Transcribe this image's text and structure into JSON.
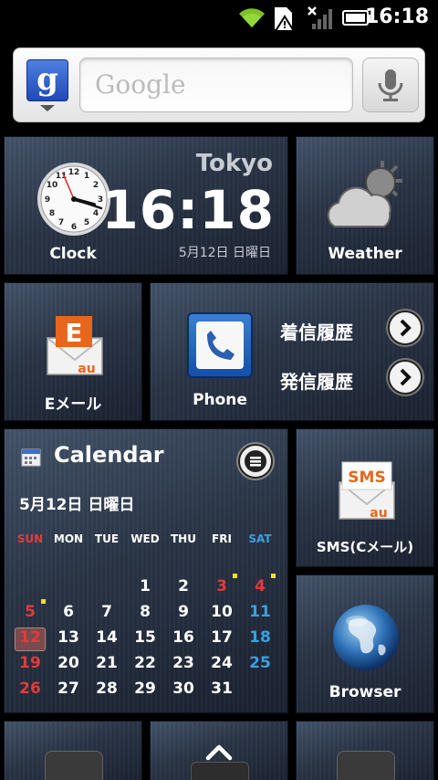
{
  "status_bar": {
    "time": "16:18",
    "icons": [
      "wifi-icon",
      "sd-card-warning-icon",
      "no-signal-icon",
      "battery-icon"
    ]
  },
  "search": {
    "logo": "g",
    "placeholder": "Google"
  },
  "tiles": {
    "clock": {
      "label": "Clock",
      "city": "Tokyo",
      "time": "16:18",
      "date": "5月12日 日曜日"
    },
    "weather": {
      "label": "Weather"
    },
    "email": {
      "label": "Eメール",
      "badge": "E",
      "brand": "au"
    },
    "phone": {
      "label": "Phone",
      "incoming": "着信履歴",
      "outgoing": "発信履歴"
    },
    "sms": {
      "label": "SMS(Cメール)",
      "badge": "SMS",
      "brand": "au"
    },
    "browser": {
      "label": "Browser"
    }
  },
  "calendar": {
    "title": "Calendar",
    "date": "5月12日 日曜日",
    "weekdays": [
      "SUN",
      "MON",
      "TUE",
      "WED",
      "THU",
      "FRI",
      "SAT"
    ],
    "weeks": [
      [
        "",
        "",
        "",
        "1",
        "2",
        "3",
        "4"
      ],
      [
        "5",
        "6",
        "7",
        "8",
        "9",
        "10",
        "11"
      ],
      [
        "12",
        "13",
        "14",
        "15",
        "16",
        "17",
        "18"
      ],
      [
        "19",
        "20",
        "21",
        "22",
        "23",
        "24",
        "25"
      ],
      [
        "26",
        "27",
        "28",
        "29",
        "30",
        "31",
        ""
      ]
    ],
    "red_days": [
      "3",
      "4",
      "5",
      "12",
      "19",
      "26"
    ],
    "blue_days": [
      "11",
      "18",
      "25"
    ],
    "today": "12",
    "event_days": [
      "3",
      "4",
      "5"
    ]
  },
  "colors": {
    "sunday": "#e23b3b",
    "saturday": "#3aa0e0",
    "accent_orange": "#e8661c",
    "google_blue": "#2a55c8"
  }
}
